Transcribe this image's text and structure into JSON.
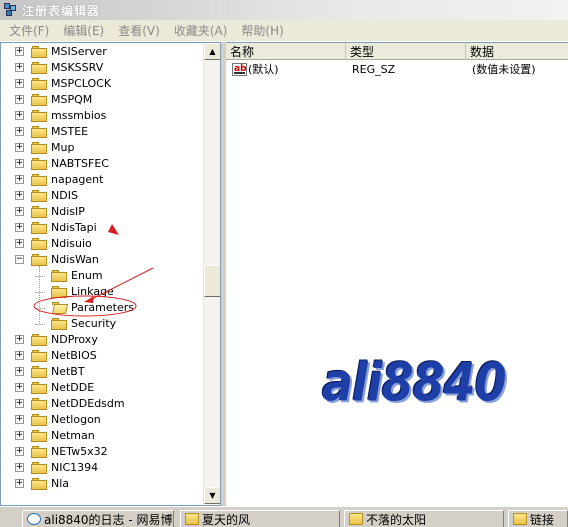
{
  "window": {
    "title": "注册表编辑器"
  },
  "menu": [
    {
      "label": "文件(F)"
    },
    {
      "label": "编辑(E)"
    },
    {
      "label": "查看(V)"
    },
    {
      "label": "收藏夹(A)"
    },
    {
      "label": "帮助(H)"
    }
  ],
  "tree": {
    "items": [
      {
        "label": "MSIServer",
        "expander": "+"
      },
      {
        "label": "MSKSSRV",
        "expander": "+"
      },
      {
        "label": "MSPCLOCK",
        "expander": "+"
      },
      {
        "label": "MSPQM",
        "expander": "+"
      },
      {
        "label": "mssmbios",
        "expander": "+"
      },
      {
        "label": "MSTEE",
        "expander": "+"
      },
      {
        "label": "Mup",
        "expander": "+"
      },
      {
        "label": "NABTSFEC",
        "expander": "+"
      },
      {
        "label": "napagent",
        "expander": "+"
      },
      {
        "label": "NDIS",
        "expander": "+"
      },
      {
        "label": "NdisIP",
        "expander": "+"
      },
      {
        "label": "NdisTapi",
        "expander": "+"
      },
      {
        "label": "Ndisuio",
        "expander": "+"
      },
      {
        "label": "NdisWan",
        "expander": "−"
      },
      {
        "label": "Enum",
        "expander": "",
        "child": true
      },
      {
        "label": "Linkage",
        "expander": "",
        "child": true
      },
      {
        "label": "Parameters",
        "expander": "",
        "child": true,
        "selected": true
      },
      {
        "label": "Security",
        "expander": "",
        "child": true
      },
      {
        "label": "NDProxy",
        "expander": "+"
      },
      {
        "label": "NetBIOS",
        "expander": "+"
      },
      {
        "label": "NetBT",
        "expander": "+"
      },
      {
        "label": "NetDDE",
        "expander": "+"
      },
      {
        "label": "NetDDEdsdm",
        "expander": "+"
      },
      {
        "label": "Netlogon",
        "expander": "+"
      },
      {
        "label": "Netman",
        "expander": "+"
      },
      {
        "label": "NETw5x32",
        "expander": "+"
      },
      {
        "label": "NIC1394",
        "expander": "+"
      },
      {
        "label": "Nla",
        "expander": "+"
      }
    ]
  },
  "list": {
    "columns": [
      "名称",
      "类型",
      "数据"
    ],
    "rows": [
      {
        "name": "(默认)",
        "type": "REG_SZ",
        "data": "(数值未设置)",
        "icon": "string-value-icon"
      }
    ]
  },
  "watermark": "ali8840",
  "taskbar": [
    {
      "label": "ali8840的日志 - 网易博...",
      "icon": "ie"
    },
    {
      "label": "夏天的风",
      "icon": "folder"
    },
    {
      "label": "不落的太阳",
      "icon": "folder"
    },
    {
      "label": "链接",
      "icon": "folder"
    }
  ],
  "colors": {
    "annotation": "#d81e1e",
    "watermark": "#1e3ea8"
  }
}
